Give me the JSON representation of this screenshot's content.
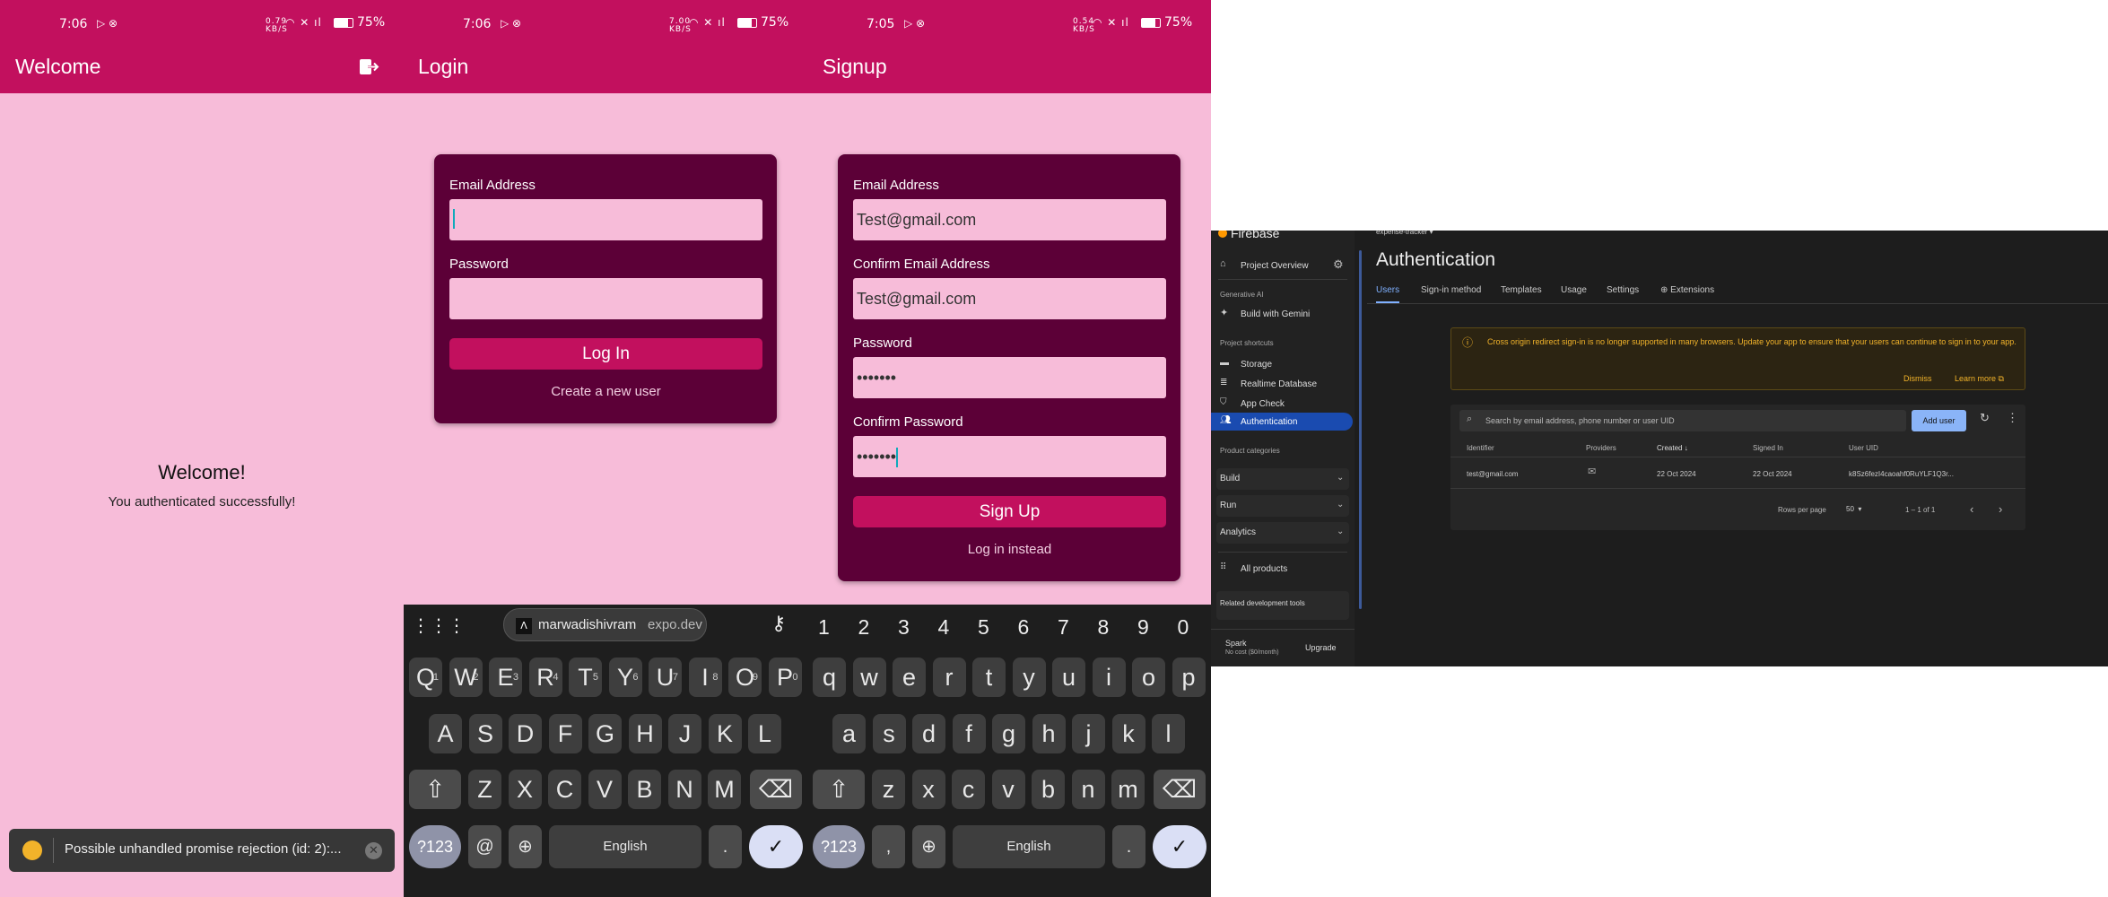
{
  "phone1": {
    "status": {
      "time": "7:06",
      "speed": "0.79\nKB/S",
      "battery": "75%"
    },
    "appbar_title": "Welcome",
    "heading": "Welcome!",
    "subtext": "You authenticated successfully!",
    "toast": "Possible unhandled promise rejection (id: 2):..."
  },
  "phone2": {
    "status": {
      "time": "7:06",
      "speed": "7.00\nKB/S",
      "battery": "75%"
    },
    "appbar_title": "Login",
    "email_label": "Email Address",
    "email_value": "",
    "password_label": "Password",
    "password_value": "",
    "login_button": "Log In",
    "create_link": "Create a new user"
  },
  "phone3": {
    "status": {
      "time": "7:05",
      "speed": "0.54\nKB/S",
      "battery": "75%"
    },
    "appbar_title": "Signup",
    "email_label": "Email Address",
    "email_value": "Test@gmail.com",
    "confirm_email_label": "Confirm Email Address",
    "confirm_email_value": "Test@gmail.com",
    "password_label": "Password",
    "password_value": "•••••••",
    "confirm_password_label": "Confirm Password",
    "confirm_password_value": "•••••••",
    "signup_button": "Sign Up",
    "login_link": "Log in instead"
  },
  "keyboard": {
    "suggestion_user": "marwadishivram",
    "suggestion_domain": "expo.dev",
    "numbers": [
      "1",
      "2",
      "3",
      "4",
      "5",
      "6",
      "7",
      "8",
      "9",
      "0"
    ],
    "row1": [
      "Q",
      "W",
      "E",
      "R",
      "T",
      "Y",
      "U",
      "I",
      "O",
      "P"
    ],
    "row1_hints": [
      "1",
      "2",
      "3",
      "4",
      "5",
      "6",
      "7",
      "8",
      "9",
      "0"
    ],
    "row2": [
      "A",
      "S",
      "D",
      "F",
      "G",
      "H",
      "J",
      "K",
      "L"
    ],
    "row3": [
      "Z",
      "X",
      "C",
      "V",
      "B",
      "N",
      "M"
    ],
    "row1b": [
      "q",
      "w",
      "e",
      "r",
      "t",
      "y",
      "u",
      "i",
      "o",
      "p"
    ],
    "row2b": [
      "a",
      "s",
      "d",
      "f",
      "g",
      "h",
      "j",
      "k",
      "l"
    ],
    "row3b": [
      "z",
      "x",
      "c",
      "v",
      "b",
      "n",
      "m"
    ],
    "symbols_key": "?123",
    "at_key": "@",
    "comma_key": ",",
    "space_label": "English",
    "period_key": "."
  },
  "firebase": {
    "brand": "Firebase",
    "project": "expense-tracker",
    "project_overview": "Project Overview",
    "generative_ai": "Generative AI",
    "build_with_gemini": "Build with Gemini",
    "project_shortcuts": "Project shortcuts",
    "shortcuts": [
      "Storage",
      "Realtime Database",
      "App Check",
      "Authentication"
    ],
    "product_categories": "Product categories",
    "categories": [
      "Build",
      "Run",
      "Analytics"
    ],
    "all_products": "All products",
    "related_tools": "Related development tools",
    "plan": "Spark",
    "plan_cost": "No cost ($0/month)",
    "upgrade": "Upgrade",
    "page_title": "Authentication",
    "tabs": [
      "Users",
      "Sign-in method",
      "Templates",
      "Usage",
      "Settings",
      "Extensions"
    ],
    "warning": "Cross origin redirect sign-in is no longer supported in many browsers. Update your app to ensure that your users can continue to sign in to your app.",
    "dismiss": "Dismiss",
    "learn_more": "Learn more",
    "search_placeholder": "Search by email address, phone number or user UID",
    "add_user": "Add user",
    "columns": [
      "Identifier",
      "Providers",
      "Created",
      "Signed In",
      "User UID"
    ],
    "rows": [
      {
        "identifier": "test@gmail.com",
        "created": "22 Oct 2024",
        "signed_in": "22 Oct 2024",
        "uid": "k8Sz6fezI4caoahf0RuYLF1Q3r..."
      }
    ],
    "rows_per_page_label": "Rows per page",
    "rows_per_page": "50",
    "pagination": "1 – 1 of 1"
  },
  "colors": {
    "primary": "#c2105e",
    "card": "#5c0037",
    "background": "#f7bcd9",
    "keyboard": "#1e1e1e",
    "firebase_active": "#1a4bb0"
  }
}
